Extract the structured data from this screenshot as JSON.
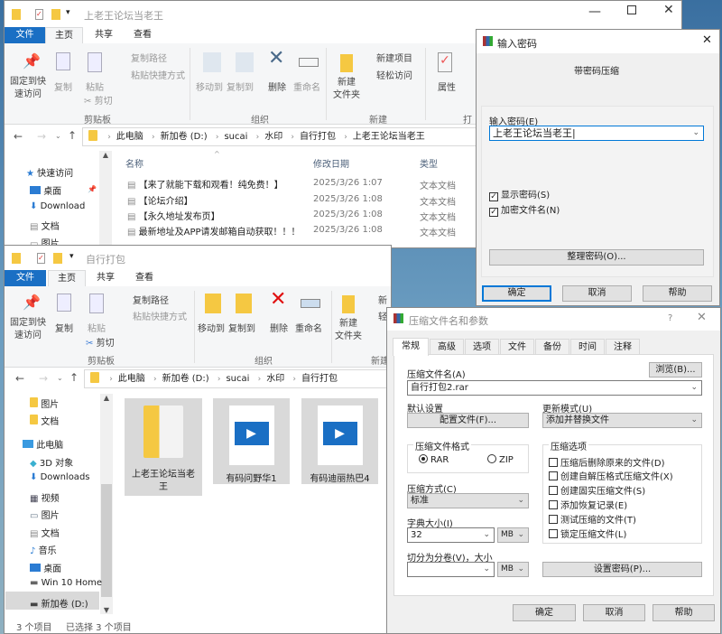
{
  "win1": {
    "title": "上老王论坛当老王",
    "tabs": [
      "文件",
      "主页",
      "共享",
      "查看"
    ],
    "ribbon": {
      "pin": "固定到快\n速访问",
      "copy": "复制",
      "paste": "粘贴",
      "copy_path": "复制路径",
      "paste_shortcut": "粘贴快捷方式",
      "cut": "剪切",
      "clipboard": "剪贴板",
      "move_to": "移动到",
      "copy_to": "复制到",
      "delete": "删除",
      "rename": "重命名",
      "organize": "组织",
      "new_folder": "新建\n文件夹",
      "new_item": "新建项目",
      "easy_access": "轻松访问",
      "new": "新建",
      "properties": "属性",
      "open": "打"
    },
    "breadcrumb": [
      "此电脑",
      "新加卷 (D:)",
      "sucai",
      "水印",
      "自行打包",
      "上老王论坛当老王"
    ],
    "columns": [
      "名称",
      "修改日期",
      "类型"
    ],
    "files": [
      {
        "name": "【来了就能下载和观看！纯免费！】",
        "date": "2025/3/26 1:07",
        "type": "文本文档"
      },
      {
        "name": "【论坛介绍】",
        "date": "2025/3/26 1:08",
        "type": "文本文档"
      },
      {
        "name": "【永久地址发布页】",
        "date": "2025/3/26 1:08",
        "type": "文本文档"
      },
      {
        "name": "最新地址及APP请发邮箱自动获取！！！",
        "date": "2025/3/26 1:08",
        "type": "文本文档"
      }
    ],
    "nav": [
      "快速访问",
      "桌面",
      "Download",
      "文档",
      "图片"
    ]
  },
  "win2": {
    "title": "自行打包",
    "tabs": [
      "文件",
      "主页",
      "共享",
      "查看"
    ],
    "ribbon": {
      "pin": "固定到快\n速访问",
      "copy": "复制",
      "paste": "粘贴",
      "copy_path": "复制路径",
      "paste_shortcut": "粘贴快捷方式",
      "cut": "剪切",
      "clipboard": "剪贴板",
      "move_to": "移动到",
      "copy_to": "复制到",
      "delete": "删除",
      "rename": "重命名",
      "organize": "组织",
      "new_folder": "新建\n文件夹",
      "new_item": "新",
      "easy_access": "轻",
      "new": "新建"
    },
    "breadcrumb": [
      "此电脑",
      "新加卷 (D:)",
      "sucai",
      "水印",
      "自行打包"
    ],
    "nav": [
      "图片",
      "文档",
      "此电脑",
      "3D 对象",
      "Downloads",
      "视频",
      "图片",
      "文档",
      "音乐",
      "桌面",
      "Win 10 Home",
      "新加卷 (D:)"
    ],
    "items": [
      "上老王论坛当老王",
      "有码问野华1",
      "有码迪丽热巴4"
    ],
    "status": {
      "count": "3 个项目",
      "selected": "已选择 3 个项目"
    }
  },
  "pwd": {
    "title": "输入密码",
    "heading": "带密码压缩",
    "label": "输入密码(E)",
    "value": "上老王论坛当老王",
    "show": "显示密码(S)",
    "encrypt_names": "加密文件名(N)",
    "show_checked": true,
    "encrypt_checked": true,
    "organize": "整理密码(O)...",
    "ok": "确定",
    "cancel": "取消",
    "help": "帮助"
  },
  "rar": {
    "title": "压缩文件名和参数",
    "help_q": "?",
    "tabs": [
      "常规",
      "高级",
      "选项",
      "文件",
      "备份",
      "时间",
      "注释"
    ],
    "archive_label": "压缩文件名(A)",
    "browse": "浏览(B)...",
    "archive_name": "自行打包2.rar",
    "profile_label": "默认设置",
    "profile_btn": "配置文件(F)...",
    "update_label": "更新模式(U)",
    "update_value": "添加并替换文件",
    "format_label": "压缩文件格式",
    "format_rar": "RAR",
    "format_zip": "ZIP",
    "format_selected": "RAR",
    "method_label": "压缩方式(C)",
    "method_value": "标准",
    "dict_label": "字典大小(I)",
    "dict_value": "32",
    "dict_unit": "MB",
    "split_label": "切分为分卷(V)，大小",
    "split_value": "",
    "split_unit": "MB",
    "options_label": "压缩选项",
    "options": [
      "压缩后删除原来的文件(D)",
      "创建自解压格式压缩文件(X)",
      "创建固实压缩文件(S)",
      "添加恢复记录(E)",
      "测试压缩的文件(T)",
      "锁定压缩文件(L)"
    ],
    "set_password": "设置密码(P)...",
    "ok": "确定",
    "cancel": "取消",
    "help": "帮助"
  }
}
